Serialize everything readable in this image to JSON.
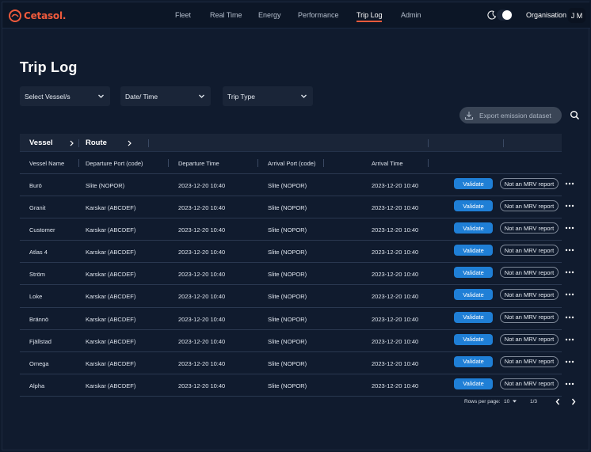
{
  "app": {
    "brand": "Cetasol.",
    "brand_color": "#ef5a3c",
    "accent": "#1f7fd6"
  },
  "nav": {
    "items": [
      {
        "label": "Fleet"
      },
      {
        "label": "Real Time"
      },
      {
        "label": "Energy"
      },
      {
        "label": "Performance"
      },
      {
        "label": "Trip Log",
        "active": true
      },
      {
        "label": "Admin"
      }
    ],
    "theme_toggle": {
      "icon": "moon-icon",
      "state": "on"
    },
    "organisation_label": "Organisation",
    "user_initials": "J M"
  },
  "page": {
    "title": "Trip Log"
  },
  "filters": {
    "vessel": "Select Vessel/s",
    "datetime": "Date/ Time",
    "trip_type": "Trip Type"
  },
  "actions": {
    "export_label": "Export emission dataset",
    "search_icon": "search-icon"
  },
  "table": {
    "groups": [
      "Vessel",
      "Route"
    ],
    "columns": [
      "Vessel Name",
      "Departure Port (code)",
      "Departure Time",
      "Arrival Port (code)",
      "Arrival Time"
    ],
    "validate_label": "Validate",
    "mrv_label": "Not an MRV report",
    "rows": [
      {
        "vessel": "Burö",
        "departure_port": "Slite (NOPOR)",
        "departure_time": "2023-12-20 10:40",
        "arrival_port": "Slite (NOPOR)",
        "arrival_time": "2023-12-20 10:40"
      },
      {
        "vessel": "Granit",
        "departure_port": "Karskar (ABCDEF)",
        "departure_time": "2023-12-20 10:40",
        "arrival_port": "Slite (NOPOR)",
        "arrival_time": "2023-12-20 10:40"
      },
      {
        "vessel": "Customer",
        "departure_port": "Karskar (ABCDEF)",
        "departure_time": "2023-12-20 10:40",
        "arrival_port": "Slite (NOPOR)",
        "arrival_time": "2023-12-20 10:40"
      },
      {
        "vessel": "Atlas 4",
        "departure_port": "Karskar (ABCDEF)",
        "departure_time": "2023-12-20 10:40",
        "arrival_port": "Slite (NOPOR)",
        "arrival_time": "2023-12-20 10:40"
      },
      {
        "vessel": "Ström",
        "departure_port": "Karskar (ABCDEF)",
        "departure_time": "2023-12-20 10:40",
        "arrival_port": "Slite (NOPOR)",
        "arrival_time": "2023-12-20 10:40"
      },
      {
        "vessel": "Loke",
        "departure_port": "Karskar (ABCDEF)",
        "departure_time": "2023-12-20 10:40",
        "arrival_port": "Slite (NOPOR)",
        "arrival_time": "2023-12-20 10:40"
      },
      {
        "vessel": "Brännö",
        "departure_port": "Karskar (ABCDEF)",
        "departure_time": "2023-12-20 10:40",
        "arrival_port": "Slite (NOPOR)",
        "arrival_time": "2023-12-20 10:40"
      },
      {
        "vessel": "Fjällstad",
        "departure_port": "Karskar (ABCDEF)",
        "departure_time": "2023-12-20 10:40",
        "arrival_port": "Slite (NOPOR)",
        "arrival_time": "2023-12-20 10:40"
      },
      {
        "vessel": "Omega",
        "departure_port": "Karskar (ABCDEF)",
        "departure_time": "2023-12-20 10:40",
        "arrival_port": "Slite (NOPOR)",
        "arrival_time": "2023-12-20 10:40"
      },
      {
        "vessel": "Alpha",
        "departure_port": "Karskar (ABCDEF)",
        "departure_time": "2023-12-20 10:40",
        "arrival_port": "Slite (NOPOR)",
        "arrival_time": "2023-12-20 10:40"
      }
    ]
  },
  "pagination": {
    "rows_per_page_label": "Rows per page:",
    "rows_per_page": "10",
    "page_info": "1/3"
  }
}
